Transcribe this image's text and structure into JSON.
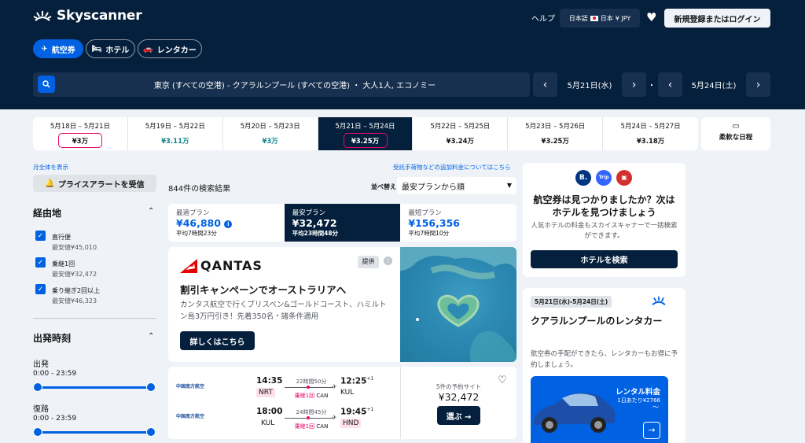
{
  "brand": {
    "name": "Skyscanner"
  },
  "header": {
    "help": "ヘルプ",
    "locale": {
      "language": "日本語",
      "country": "日本",
      "currency": "¥ JPY"
    },
    "login": "新規登録またはログイン"
  },
  "tabs": [
    {
      "label": "航空券",
      "icon": "plane-icon",
      "active": true
    },
    {
      "label": "ホテル",
      "icon": "bed-icon",
      "active": false
    },
    {
      "label": "レンタカー",
      "icon": "car-icon",
      "active": false
    }
  ],
  "search": {
    "summary": "東京 (すべての空港) - クアラルンプール (すべての空港) ・ 大人1人, エコノミー",
    "depart_date": "5月21日(水)",
    "return_date": "5月24日(土)",
    "separator": "・"
  },
  "date_strip": [
    {
      "dates": "5月18日 – 5月21日",
      "price": "¥3万",
      "circled": true,
      "selected": false,
      "green": false
    },
    {
      "dates": "5月19日 – 5月22日",
      "price": "¥3.11万",
      "circled": false,
      "selected": false,
      "green": true
    },
    {
      "dates": "5月20日 – 5月23日",
      "price": "¥3万",
      "circled": false,
      "selected": false,
      "green": true
    },
    {
      "dates": "5月21日 – 5月24日",
      "price": "¥3.25万",
      "circled": true,
      "selected": true,
      "green": false
    },
    {
      "dates": "5月22日 – 5月25日",
      "price": "¥3.24万",
      "circled": false,
      "selected": false,
      "green": false
    },
    {
      "dates": "5月23日 – 5月26日",
      "price": "¥3.25万",
      "circled": false,
      "selected": false,
      "green": false
    },
    {
      "dates": "5月24日 – 5月27日",
      "price": "¥3.18万",
      "circled": false,
      "selected": false,
      "green": false
    }
  ],
  "flexible_dates": "柔軟な日程",
  "sidebar": {
    "show_month": "月全体を表示",
    "price_alert": "プライスアラートを受信",
    "stops": {
      "title": "経由地",
      "items": [
        {
          "label": "直行便",
          "sub": "最安値¥45,010"
        },
        {
          "label": "乗継1回",
          "sub": "最安値¥32,472"
        },
        {
          "label": "乗り継ぎ2回以上",
          "sub": "最安値¥46,323"
        }
      ]
    },
    "times": {
      "title": "出発時刻",
      "depart_label": "出発",
      "depart_range": "0:00 - 23:59",
      "return_label": "復路",
      "return_range": "0:00 - 23:59"
    }
  },
  "results": {
    "baggage_link": "受託手荷物などの追加料金についてはこちら",
    "count": "844件の検索結果",
    "sort_label": "並べ替え",
    "sort_value": "最安プランから順",
    "sort_tabs": [
      {
        "label": "最適プラン",
        "price": "¥46,880",
        "sub": "平均7時間23分",
        "selected": false,
        "info": true
      },
      {
        "label": "最安プラン",
        "price": "¥32,472",
        "sub": "平均23時間48分",
        "selected": true,
        "info": false
      },
      {
        "label": "最短プラン",
        "price": "¥156,356",
        "sub": "平均7時間10分",
        "selected": false,
        "info": false
      }
    ]
  },
  "ad": {
    "brand": "QANTAS",
    "sponsored": "提供",
    "headline": "割引キャンペーンでオーストラリアへ",
    "body": "カンタス航空で行くブリスベン&ゴールドコースト、ハミルトン島3万円引き！先着350名・諸条件適用",
    "cta": "詳しくはこちら"
  },
  "flight_card": {
    "airline": "中国南方航空",
    "outbound": {
      "dep_time": "14:35",
      "dep_airport": "NRT",
      "duration": "22時間50分",
      "stops": "乗継1回",
      "via": "CAN",
      "arr_time": "12:25",
      "arr_day": "+1",
      "arr_airport": "KUL"
    },
    "inbound": {
      "dep_time": "18:00",
      "dep_airport": "KUL",
      "duration": "24時間45分",
      "stops": "乗継1回",
      "via": "CAN",
      "arr_time": "19:45",
      "arr_day": "+1",
      "arr_airport": "HND"
    },
    "sites": "5件の予約サイト",
    "price": "¥32,472",
    "select": "選ぶ →"
  },
  "hotel_promo": {
    "logos": [
      "B.",
      "Trip",
      "▣"
    ],
    "title": "航空券は見つかりましたか？次はホテルを見つけましょう",
    "body": "人気ホテルの料金もスカイスキャナーで一括検索ができます。",
    "cta": "ホテルを検索"
  },
  "car_promo": {
    "dates": "5月21日(水)-5月24日(土)",
    "title": "クアラルンプールのレンタカー",
    "body": "航空券の手配ができたら、レンタカーもお得に予約しましょう。",
    "rate_label": "レンタル料金",
    "rate_value": "1日あたり¥2766",
    "rate_tail": "〜"
  },
  "colors": {
    "navy": "#05203c",
    "blue": "#0062e3",
    "accent_pink": "#e70866",
    "green": "#0c838a"
  }
}
